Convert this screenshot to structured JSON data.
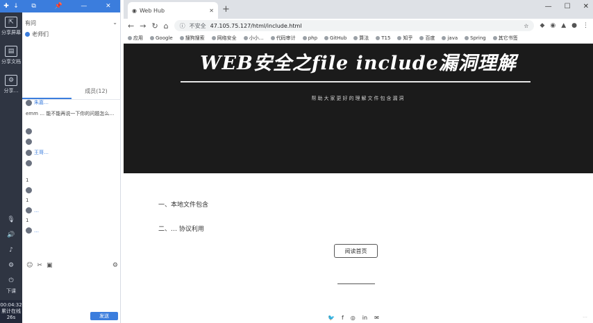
{
  "rail": {
    "top_icons": [
      "✚",
      "↓",
      "⊟"
    ],
    "items": [
      {
        "label": "分享屏幕"
      },
      {
        "label": "分享文档"
      },
      {
        "label": "分享…"
      }
    ],
    "bottom_label": "下课",
    "timer": "00:04:32",
    "timer_sub1": "累计在线",
    "timer_sub2": "26s"
  },
  "chat": {
    "title": "有问",
    "title_right": "⌄",
    "sub": "老师们",
    "tabs": [
      "",
      "成员(12)"
    ],
    "messages": [
      {
        "name": "朱嘉…",
        "text": "",
        "blue": true
      },
      {
        "name": "",
        "text": "emm …   能不能再说一下你的问题怎么…",
        "blue": false
      },
      {
        "name": "",
        "text": "",
        "blue": false
      },
      {
        "name": "",
        "text": "",
        "blue": false
      },
      {
        "name": "王哥…",
        "text": "",
        "blue": true
      },
      {
        "name": "",
        "text": "",
        "blue": false
      },
      {
        "name": "",
        "text": "",
        "blue": false
      },
      {
        "name": "",
        "text": "",
        "blue": false
      },
      {
        "name": "",
        "text": "1",
        "blue": false
      },
      {
        "name": "",
        "text": "",
        "blue": false
      },
      {
        "name": "",
        "text": "1",
        "blue": false
      },
      {
        "name": "…",
        "text": "",
        "blue": true
      },
      {
        "name": "",
        "text": "1",
        "blue": false
      },
      {
        "name": "",
        "text": "",
        "blue": false
      },
      {
        "name": "…",
        "text": "",
        "blue": true
      }
    ],
    "send_label": "发送"
  },
  "browser": {
    "tab_title": "Web Hub",
    "address_prefix": "不安全",
    "address": "47.105.75.127/html/include.html",
    "bookmarks": [
      "应用",
      "Google",
      "搜狗搜索",
      "网络安全",
      "小小…",
      "代码审计",
      "php",
      "GitHub",
      "算法",
      "T15",
      "知乎",
      "百度",
      "java",
      "Spring",
      "其它书签"
    ]
  },
  "page": {
    "hero_title": "WEB安全之file include漏洞理解",
    "hero_sub": "帮助大家更好的理解文件包含漏洞",
    "toc": [
      "一、本地文件包含",
      "二、…     协议利用"
    ],
    "read_button": "阅读首页",
    "social": [
      "🐦",
      "f",
      "◎",
      "in",
      "✉"
    ],
    "watermark": "…"
  }
}
